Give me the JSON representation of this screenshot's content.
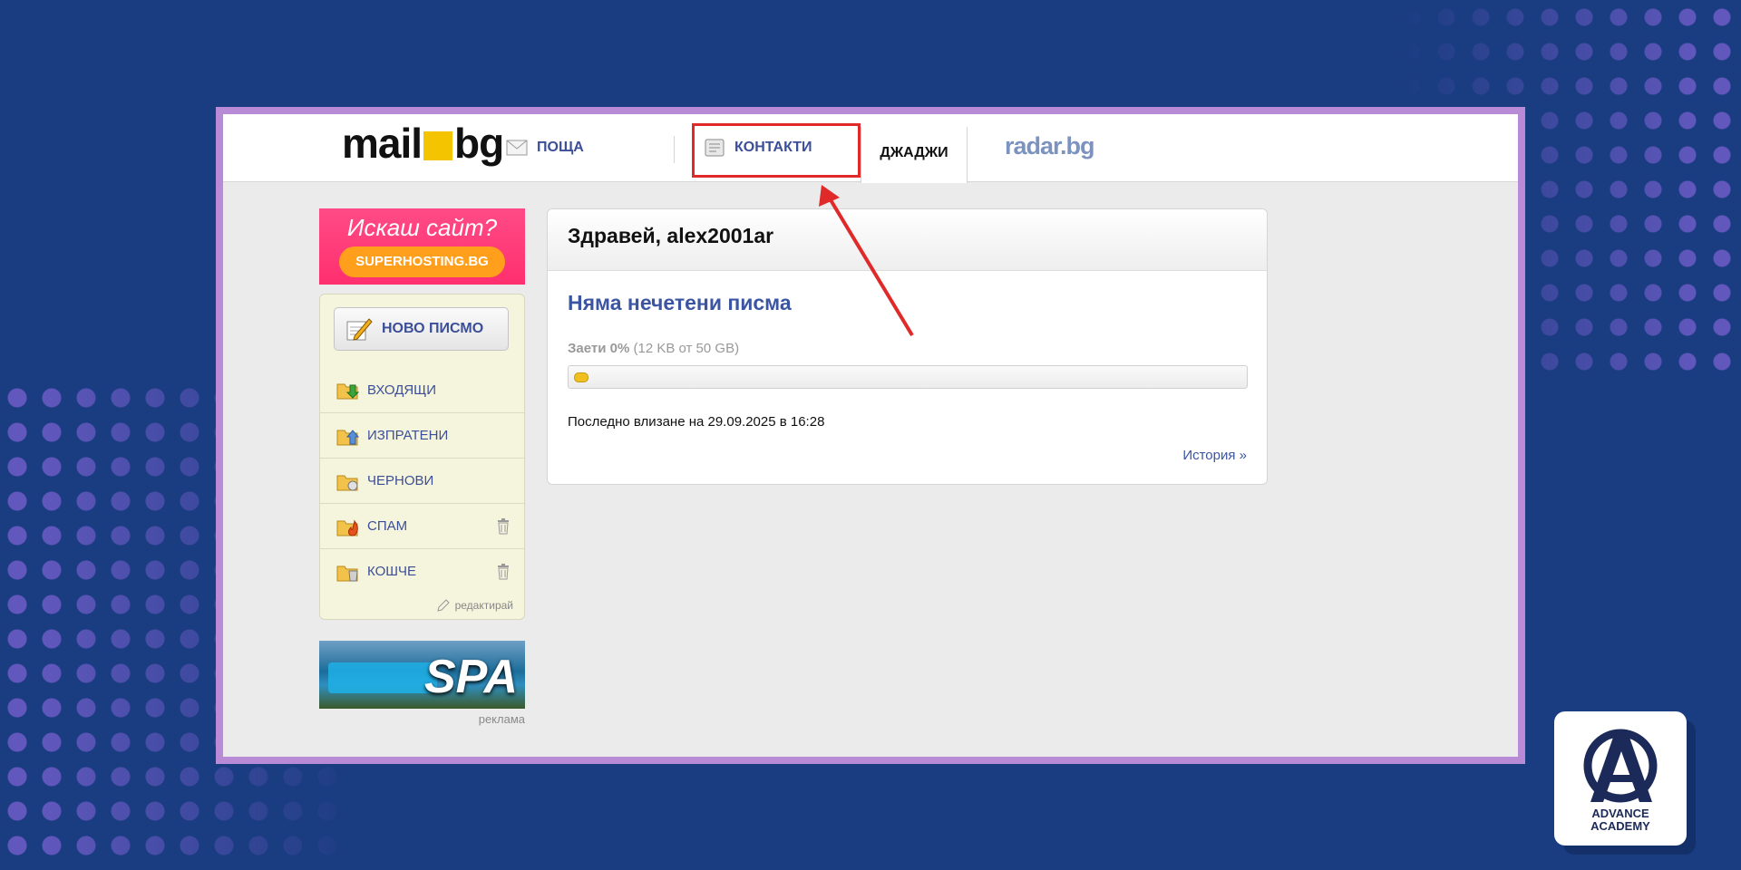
{
  "header": {
    "logo_left": "mail",
    "logo_right": "bg",
    "nav": {
      "mail": "ПОЩА",
      "contacts": "КОНТАКТИ",
      "gadgets": "ДЖАДЖИ",
      "radar": "radar.bg"
    }
  },
  "ads": {
    "top_heading": "Искаш сайт?",
    "top_button": "SUPERHOSTING.BG",
    "bottom_text": "SPA",
    "label": "реклама"
  },
  "sidebar": {
    "new_message": "НОВО ПИСМО",
    "folders": [
      {
        "label": "ВХОДЯЩИ",
        "icon": "inbox-folder-icon"
      },
      {
        "label": "ИЗПРАТЕНИ",
        "icon": "sent-folder-icon"
      },
      {
        "label": "ЧЕРНОВИ",
        "icon": "drafts-folder-icon"
      },
      {
        "label": "СПАМ",
        "icon": "spam-folder-icon"
      },
      {
        "label": "КОШЧЕ",
        "icon": "trash-folder-icon"
      }
    ],
    "edit": "редактирай"
  },
  "main": {
    "greeting": "Здравей, alex2001ar",
    "unread": "Няма нечетени писма",
    "usage_label": "Заети 0%",
    "usage_detail": "(12 KB от 50 GB)",
    "usage_fraction": 0.0,
    "last_login": "Последно влизане на 29.09.2025 в 16:28",
    "history_link": "История »"
  },
  "brand": {
    "line1": "ADVANCE",
    "line2": "ACADEMY"
  },
  "colors": {
    "background": "#1a3c80",
    "frame": "#b98ad6",
    "link": "#3b4f99",
    "highlight": "#e02a2a"
  }
}
